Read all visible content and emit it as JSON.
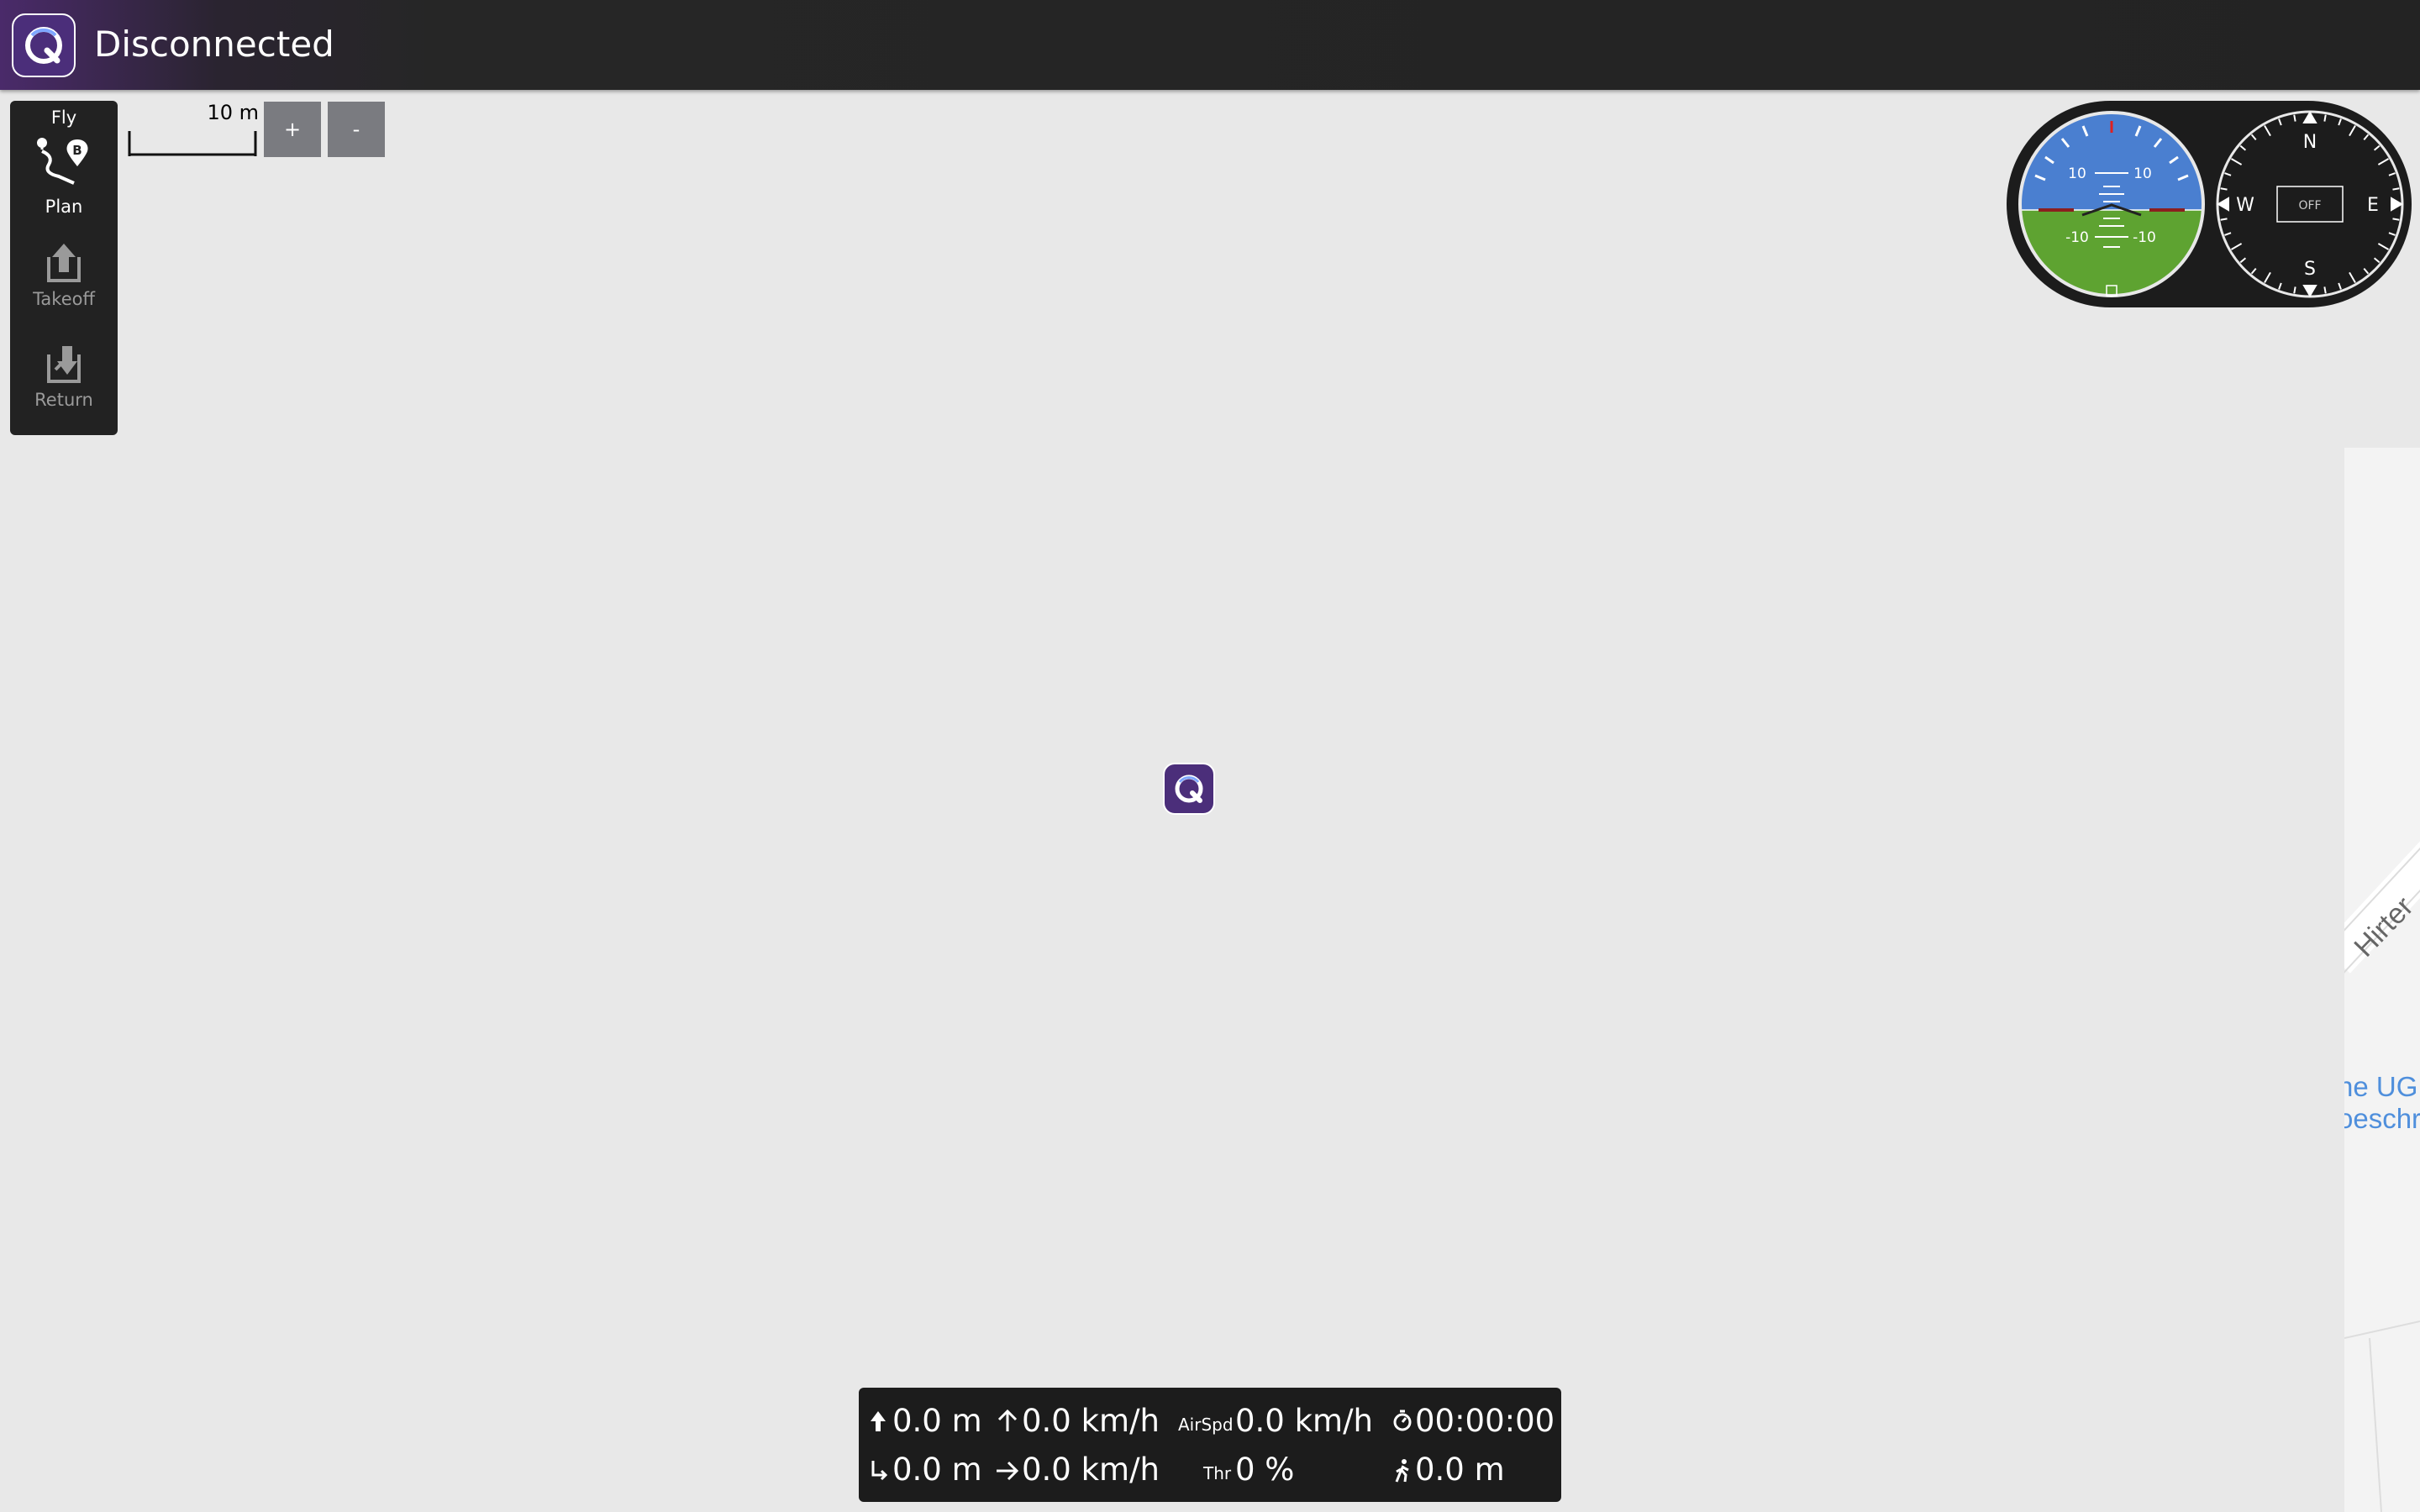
{
  "topbar": {
    "status": "Disconnected",
    "logo_icon": "qgc-logo-icon"
  },
  "toolstrip": {
    "items": [
      {
        "label": "Fly",
        "icon": "",
        "enabled": true
      },
      {
        "label": "Plan",
        "icon": "plan-route-icon",
        "enabled": true
      },
      {
        "label": "Takeoff",
        "icon": "takeoff-icon",
        "enabled": false
      },
      {
        "label": "Return",
        "icon": "return-icon",
        "enabled": false
      }
    ]
  },
  "map": {
    "scale_text": "10 m",
    "zoom_in_label": "+",
    "zoom_out_label": "-",
    "street_label": "Hirter",
    "poi_line1": "ne UG",
    "poi_line2": "oeschr"
  },
  "instruments": {
    "attitude_pitch_labels": [
      "10",
      "10",
      "-10",
      "-10"
    ],
    "compass": {
      "n": "N",
      "e": "E",
      "s": "S",
      "w": "W",
      "heading_box": "OFF"
    },
    "colors": {
      "sky": "#4a7fd0",
      "ground": "#5ea331",
      "panel": "#1c1c1c"
    }
  },
  "telemetry": {
    "altitude": "0.0 m",
    "climb_rate": "0.0 km/h",
    "airspeed_label": "AirSpd",
    "airspeed": "0.0 km/h",
    "flight_time": "00:00:00",
    "distance_to_home": "0.0 m",
    "ground_speed": "0.0 km/h",
    "throttle_label": "Thr",
    "throttle": "0 %",
    "distance_to_pilot": "0.0 m"
  },
  "accent_color": "#4b2e7a"
}
